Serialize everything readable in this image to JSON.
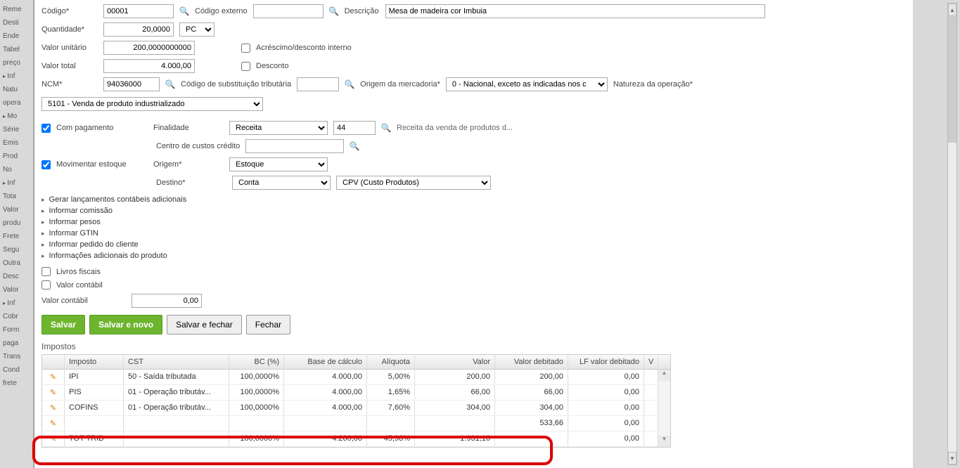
{
  "sidebar": {
    "items": [
      {
        "label": "Reme"
      },
      {
        "label": "Desti"
      },
      {
        "label": "Ende"
      },
      {
        "label": "Tabel"
      },
      {
        "label": "preço"
      },
      {
        "label": "Inf",
        "expand": true
      },
      {
        "label": "Natu"
      },
      {
        "label": "opera"
      },
      {
        "label": "Mo",
        "expand": true
      },
      {
        "label": "Série"
      },
      {
        "label": "Emis"
      },
      {
        "label": "Prod"
      },
      {
        "label": "No"
      },
      {
        "label": "Inf",
        "expand": true
      },
      {
        "label": "Tota"
      },
      {
        "label": "Valor"
      },
      {
        "label": "produ"
      },
      {
        "label": "Frete"
      },
      {
        "label": "Segu"
      },
      {
        "label": "Outra"
      },
      {
        "label": "Desc"
      },
      {
        "label": "Valor"
      },
      {
        "label": "Inf",
        "expand": true
      },
      {
        "label": "Cobr"
      },
      {
        "label": "Form"
      },
      {
        "label": "paga"
      },
      {
        "label": "Trans"
      },
      {
        "label": "Cond"
      },
      {
        "label": "frete"
      }
    ]
  },
  "form": {
    "codigo": {
      "label": "Código",
      "value": "00001"
    },
    "codigo_ext": {
      "label": "Código externo",
      "value": ""
    },
    "descricao": {
      "label": "Descrição",
      "value": "Mesa de madeira cor Imbuia"
    },
    "quantidade": {
      "label": "Quantidade",
      "value": "20,0000",
      "unit": "PC"
    },
    "valor_unit": {
      "label": "Valor unitário",
      "value": "200,0000000000"
    },
    "acrescimo": {
      "label": "Acréscimo/desconto interno",
      "checked": false
    },
    "valor_total": {
      "label": "Valor total",
      "value": "4.000,00"
    },
    "desconto": {
      "label": "Desconto",
      "checked": false
    },
    "ncm": {
      "label": "NCM",
      "value": "94036000"
    },
    "cst_sub": {
      "label": "Código de substituição tributária",
      "value": ""
    },
    "origem_merc": {
      "label": "Origem da mercadoria",
      "value": "0 - Nacional, exceto as indicadas nos c"
    },
    "natureza": {
      "label": "Natureza da operação",
      "value": "5101 - Venda de produto industrializado"
    },
    "com_pag": {
      "label": "Com pagamento",
      "checked": true
    },
    "finalidade": {
      "label": "Finalidade",
      "value": "Receita",
      "code": "44",
      "desc": "Receita da venda de produtos d..."
    },
    "centro_custos": {
      "label": "Centro de custos crédito",
      "value": ""
    },
    "mov_estoque": {
      "label": "Movimentar estoque",
      "checked": true
    },
    "origem": {
      "label": "Origem",
      "value": "Estoque"
    },
    "destino": {
      "label": "Destino",
      "value": "Conta",
      "extra": "CPV (Custo Produtos)"
    },
    "livros_fiscais": {
      "label": "Livros fiscais",
      "checked": false
    },
    "valor_contabil_chk": {
      "label": "Valor contábil",
      "checked": false
    },
    "valor_contabil": {
      "label": "Valor contábil",
      "value": "0,00"
    }
  },
  "expanders": [
    "Gerar lançamentos contábeis adicionais",
    "Informar comissão",
    "Informar pesos",
    "Informar GTIN",
    "Informar pedido do cliente",
    "Informações adicionais do produto"
  ],
  "buttons": {
    "salvar": "Salvar",
    "salvar_novo": "Salvar e novo",
    "salvar_fechar": "Salvar e fechar",
    "fechar": "Fechar"
  },
  "tax_section": {
    "title": "Impostos",
    "headers": {
      "imposto": "Imposto",
      "cst": "CST",
      "bcp": "BC (%)",
      "base": "Base de cálculo",
      "aliq": "Alíquota",
      "valor": "Valor",
      "deb": "Valor debitado",
      "lf": "LF valor debitado",
      "v": "V"
    },
    "rows": [
      {
        "imposto": "IPI",
        "cst": "50 - Saída tributada",
        "bcp": "100,0000%",
        "base": "4.000,00",
        "aliq": "5,00%",
        "valor": "200,00",
        "deb": "200,00",
        "lf": "0,00"
      },
      {
        "imposto": "PIS",
        "cst": "01 - Operação tributáv...",
        "bcp": "100,0000%",
        "base": "4.000,00",
        "aliq": "1,65%",
        "valor": "66,00",
        "deb": "66,00",
        "lf": "0,00"
      },
      {
        "imposto": "COFINS",
        "cst": "01 - Operação tributáv...",
        "bcp": "100,0000%",
        "base": "4.000,00",
        "aliq": "7,60%",
        "valor": "304,00",
        "deb": "304,00",
        "lf": "0,00"
      },
      {
        "imposto": "",
        "cst": "",
        "bcp": "",
        "base": "",
        "aliq": "",
        "valor": "",
        "deb": "533,66",
        "lf": "0,00"
      },
      {
        "imposto": "TOT TRIB",
        "cst": "",
        "bcp": "100,0000%",
        "base": "4.200,00",
        "aliq": "45,98%",
        "valor": "1.931,16",
        "deb": "",
        "lf": "0,00"
      }
    ]
  }
}
